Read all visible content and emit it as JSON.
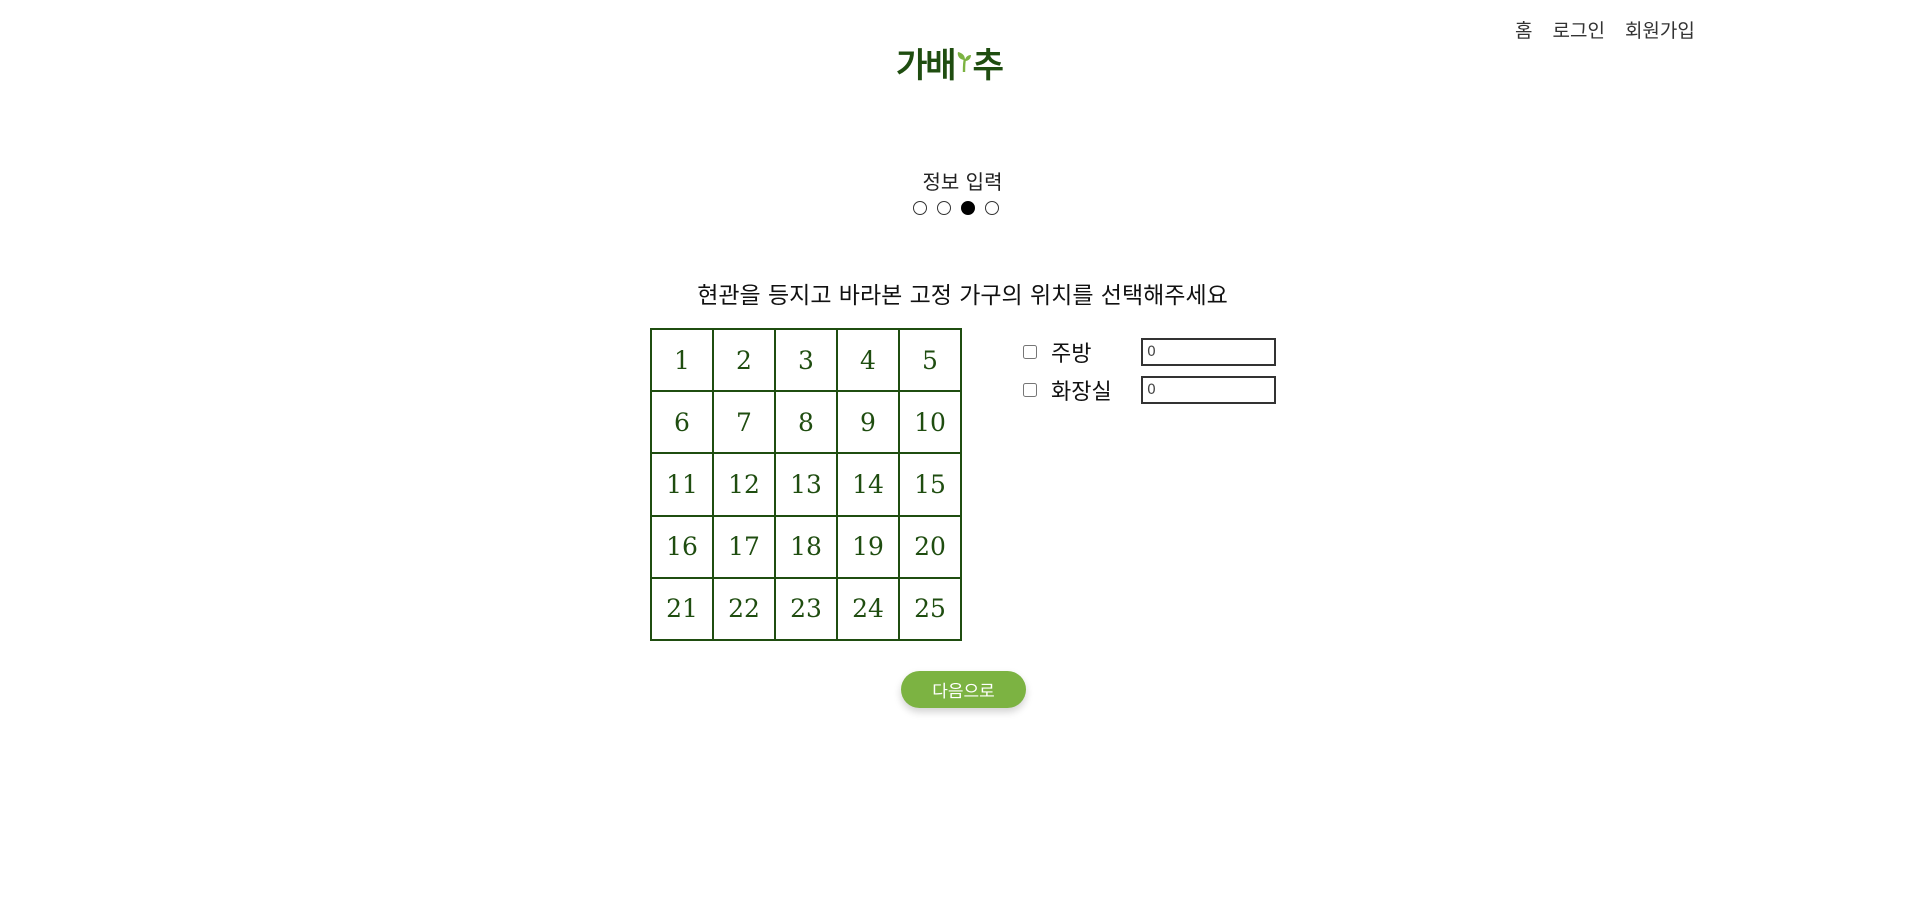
{
  "nav": {
    "home": "홈",
    "login": "로그인",
    "signup": "회원가입"
  },
  "logo": {
    "text_before": "가배",
    "text_after": "추",
    "color": "#1f4d10",
    "accent": "#7cb342"
  },
  "step": {
    "title": "정보 입력",
    "total": 4,
    "current": 3
  },
  "question": "현관을 등지고 바라본 고정 가구의 위치를 선택해주세요",
  "grid": {
    "cells": [
      "1",
      "2",
      "3",
      "4",
      "5",
      "6",
      "7",
      "8",
      "9",
      "10",
      "11",
      "12",
      "13",
      "14",
      "15",
      "16",
      "17",
      "18",
      "19",
      "20",
      "21",
      "22",
      "23",
      "24",
      "25"
    ]
  },
  "options": [
    {
      "label": "주방",
      "checked": false,
      "value": "0"
    },
    {
      "label": "화장실",
      "checked": false,
      "value": "0"
    }
  ],
  "next_button": {
    "label": "다음으로",
    "color": "#7cb342"
  }
}
